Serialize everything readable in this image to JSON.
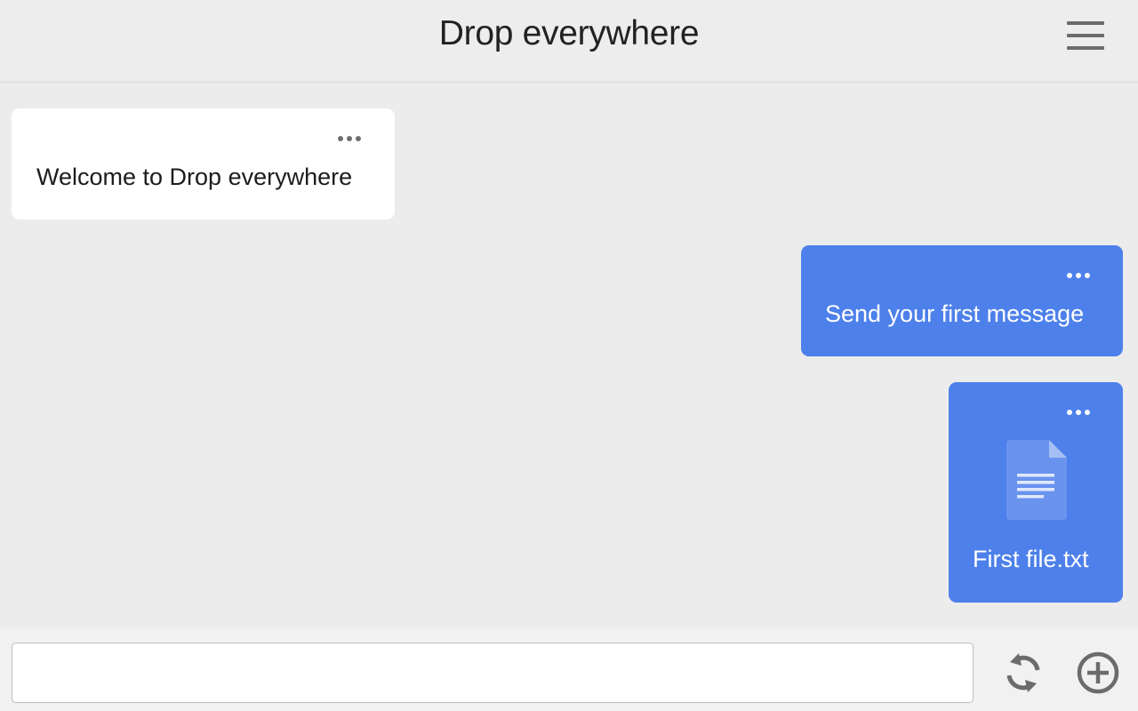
{
  "header": {
    "title": "Drop everywhere",
    "menu_icon": "hamburger-menu-icon"
  },
  "messages": [
    {
      "direction": "incoming",
      "type": "text",
      "text": "Welcome to Drop everywhere",
      "options_icon": "more-horizontal-icon"
    },
    {
      "direction": "outgoing",
      "type": "text",
      "text": "Send your first message",
      "options_icon": "more-horizontal-icon"
    },
    {
      "direction": "outgoing",
      "type": "file",
      "file_name": "First file.txt",
      "file_icon": "document-file-icon",
      "options_icon": "more-horizontal-icon"
    }
  ],
  "composer": {
    "input_value": "",
    "input_placeholder": "",
    "refresh_icon": "refresh-icon",
    "add_icon": "plus-circle-icon"
  },
  "colors": {
    "background": "#ececec",
    "incoming_bubble": "#ffffff",
    "outgoing_bubble": "#4d80ea",
    "icon_gray": "#6b6b6b"
  }
}
